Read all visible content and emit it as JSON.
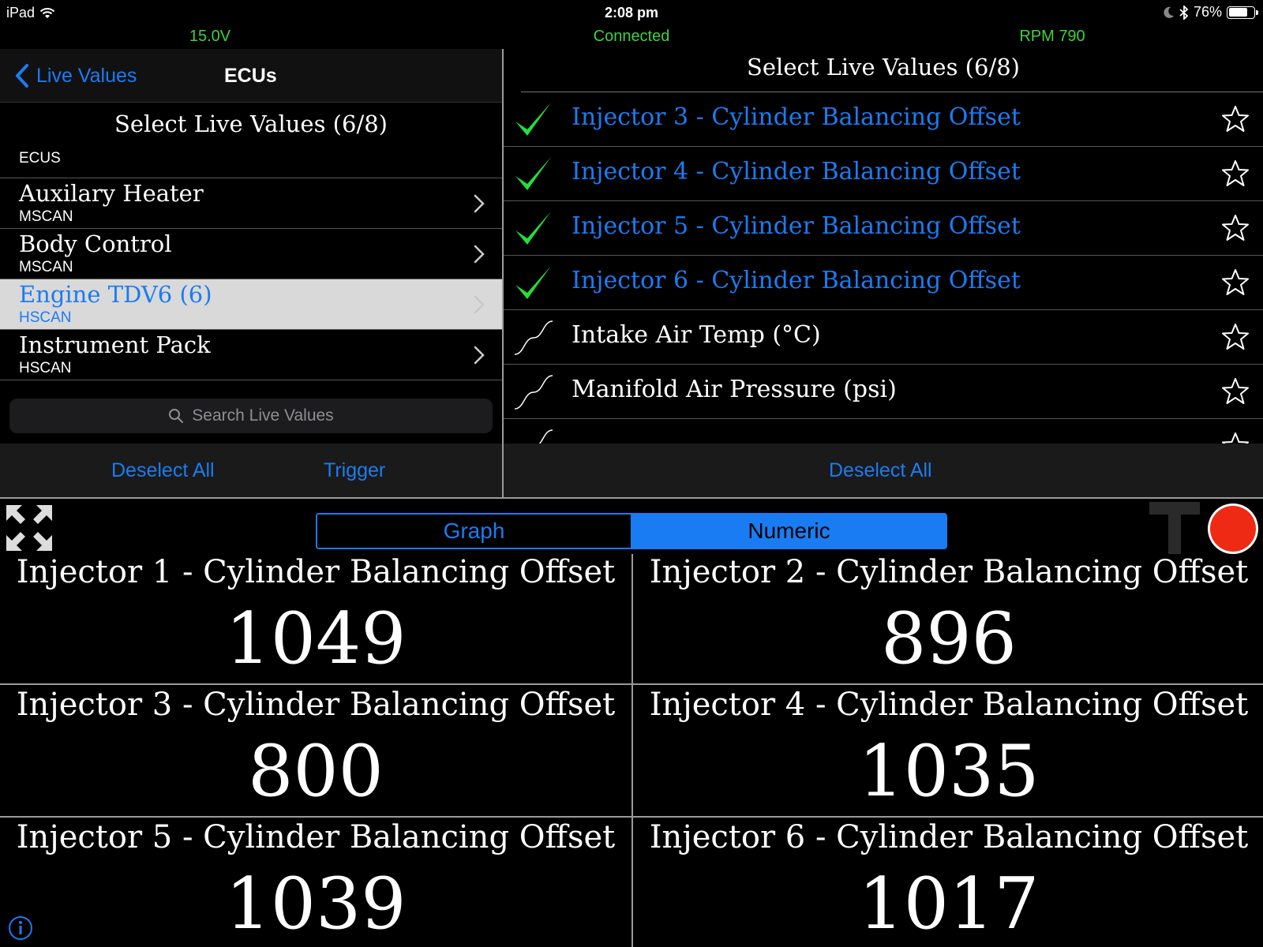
{
  "status_bar": {
    "device": "iPad",
    "time": "2:08 pm",
    "battery": "76%",
    "battery_level": 0.76
  },
  "info_row": {
    "voltage": "15.0V",
    "connection": "Connected",
    "rpm": "RPM 790"
  },
  "left_panel": {
    "back_label": "Live Values",
    "title": "ECUs",
    "header": "Select Live Values (6/8)",
    "section_label": "ECUS",
    "ecus": [
      {
        "name": "Auxilary Heater",
        "bus": "MSCAN"
      },
      {
        "name": "Body Control",
        "bus": "MSCAN"
      },
      {
        "name": "Engine TDV6 (6)",
        "bus": "HSCAN",
        "selected": true
      },
      {
        "name": "Instrument Pack",
        "bus": "HSCAN"
      }
    ],
    "search_placeholder": "Search Live Values",
    "deselect_all": "Deselect All",
    "trigger": "Trigger"
  },
  "right_panel": {
    "header": "Select Live Values (6/8)",
    "live_values": [
      {
        "label": "Injector 3 - Cylinder Balancing Offset",
        "checked": true
      },
      {
        "label": "Injector 4 - Cylinder Balancing Offset",
        "checked": true
      },
      {
        "label": "Injector 5 - Cylinder Balancing Offset",
        "checked": true
      },
      {
        "label": "Injector 6 - Cylinder Balancing Offset",
        "checked": true
      },
      {
        "label": "Intake Air Temp (°C)",
        "checked": false
      },
      {
        "label": "Manifold Air Pressure (psi)",
        "checked": false
      }
    ],
    "deselect_all": "Deselect All"
  },
  "segmented": {
    "graph": "Graph",
    "numeric": "Numeric",
    "selected": "numeric"
  },
  "readouts": [
    {
      "title": "Injector 1 - Cylinder Balancing Offset",
      "value": "1049"
    },
    {
      "title": "Injector 2 - Cylinder Balancing Offset",
      "value": "896"
    },
    {
      "title": "Injector 3 - Cylinder Balancing Offset",
      "value": "800"
    },
    {
      "title": "Injector 4 - Cylinder Balancing Offset",
      "value": "1035"
    },
    {
      "title": "Injector 5 - Cylinder Balancing Offset",
      "value": "1039"
    },
    {
      "title": "Injector 6 - Cylinder Balancing Offset",
      "value": "1017"
    }
  ],
  "colors": {
    "accent": "#1a7cf2",
    "status_green": "#3dd23d",
    "check_green": "#22e03a",
    "record_red": "#ee2a14"
  }
}
